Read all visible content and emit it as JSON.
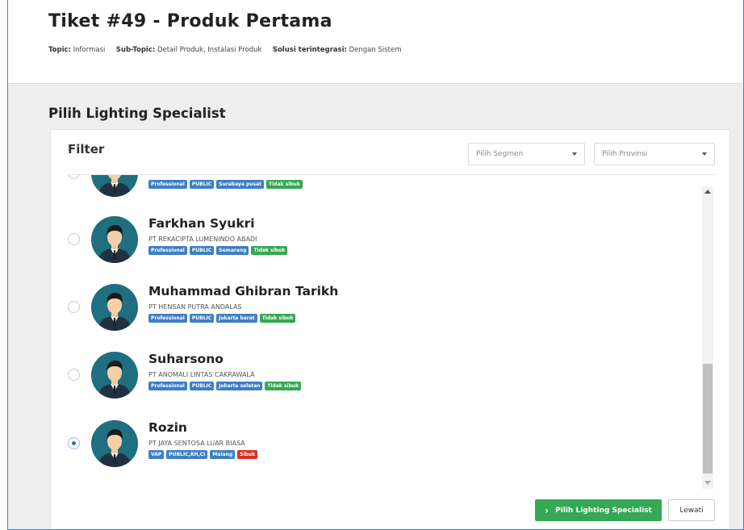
{
  "ticket": {
    "title": "Tiket #49 - Produk Pertama",
    "topic_label": "Topic:",
    "topic_value": "Informasi",
    "subtopic_label": "Sub-Topic:",
    "subtopic_value": "Detail Produk, Instalasi Produk",
    "solution_label": "Solusi terintegrasi:",
    "solution_value": "Dengan Sistem"
  },
  "section_title": "Pilih Lighting Specialist",
  "filter": {
    "label": "Filter",
    "segment_placeholder": "Pilih Segmen",
    "province_placeholder": "Pilih Provinsi"
  },
  "specialists": [
    {
      "name": "",
      "company": "",
      "tags": [
        {
          "text": "Professional",
          "color": "blue"
        },
        {
          "text": "PUBLIC",
          "color": "blue"
        },
        {
          "text": "Surabaya pusat",
          "color": "blue"
        },
        {
          "text": "Tidak sibuk",
          "color": "green"
        }
      ],
      "selected": false
    },
    {
      "name": "Farkhan Syukri",
      "company": "PT REKACIPTA LUMENINDO ABADI",
      "tags": [
        {
          "text": "Professional",
          "color": "blue"
        },
        {
          "text": "PUBLIC",
          "color": "blue"
        },
        {
          "text": "Semarang",
          "color": "blue"
        },
        {
          "text": "Tidak sibuk",
          "color": "green"
        }
      ],
      "selected": false
    },
    {
      "name": "Muhammad Ghibran Tarikh",
      "company": "PT HENSAN PUTRA ANDALAS",
      "tags": [
        {
          "text": "Professional",
          "color": "blue"
        },
        {
          "text": "PUBLIC",
          "color": "blue"
        },
        {
          "text": "Jakarta barat",
          "color": "blue"
        },
        {
          "text": "Tidak sibuk",
          "color": "green"
        }
      ],
      "selected": false
    },
    {
      "name": "Suharsono",
      "company": "PT ANOMALI LINTAS CAKRAWALA",
      "tags": [
        {
          "text": "Professional",
          "color": "blue"
        },
        {
          "text": "PUBLIC",
          "color": "blue"
        },
        {
          "text": "Jakarta selatan",
          "color": "blue"
        },
        {
          "text": "Tidak sibuk",
          "color": "green"
        }
      ],
      "selected": false
    },
    {
      "name": "Rozin",
      "company": "PT JAYA SENTOSA LUAR BIASA",
      "tags": [
        {
          "text": "VAP",
          "color": "blue"
        },
        {
          "text": "PUBLIC,RH,CI",
          "color": "blue"
        },
        {
          "text": "Malang",
          "color": "blue"
        },
        {
          "text": "Sibuk",
          "color": "red"
        }
      ],
      "selected": true
    }
  ],
  "actions": {
    "primary": "Pilih Lighting Specialist",
    "secondary": "Lewati"
  },
  "colors": {
    "accent_green": "#34a853",
    "tag_blue": "#3d7fc6",
    "tag_red": "#d93025",
    "avatar_bg": "#1f6f80"
  }
}
